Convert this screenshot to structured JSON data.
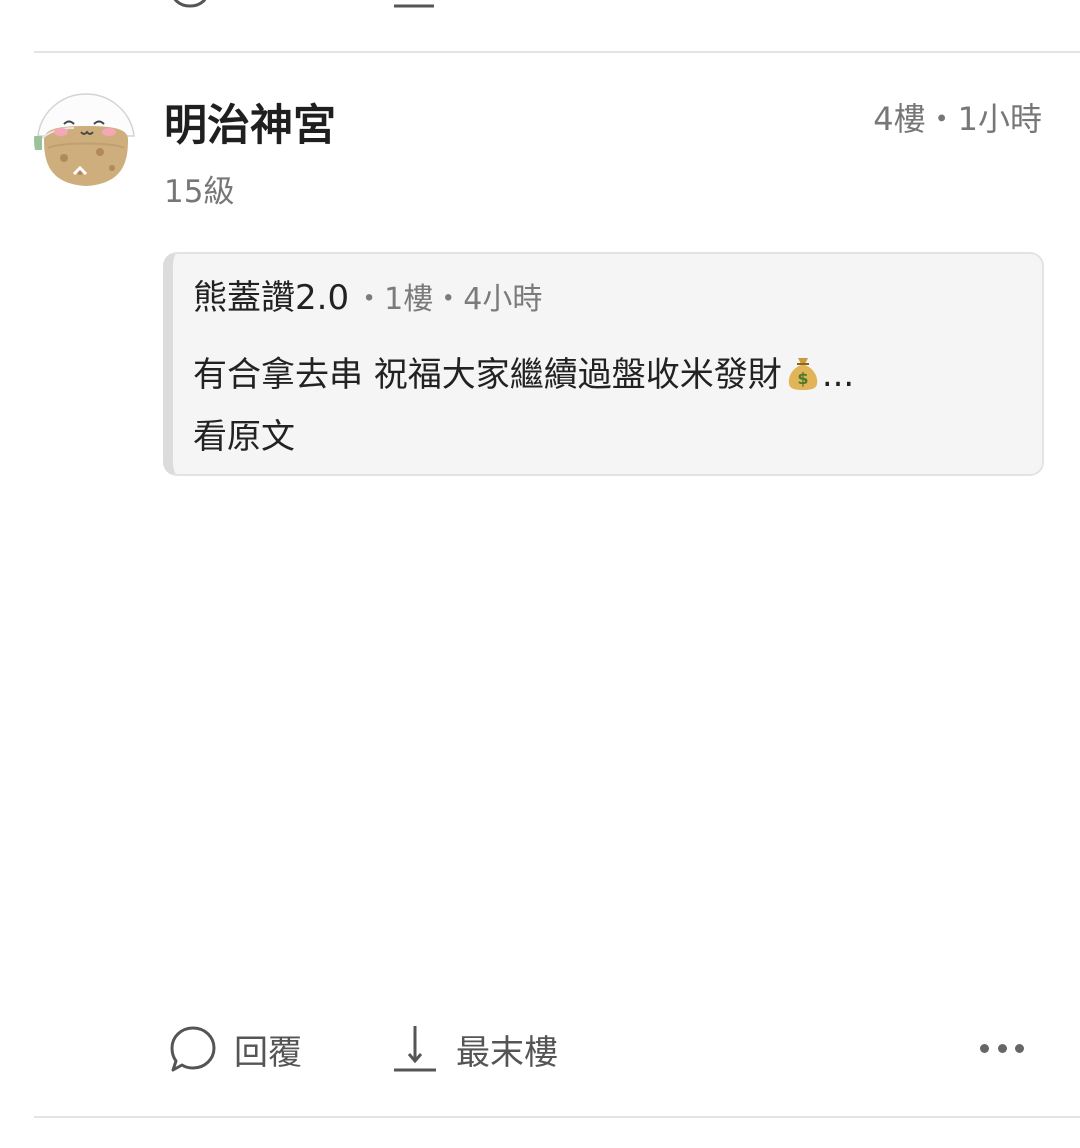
{
  "post": {
    "author": "明治神宮",
    "level": "15級",
    "floor": "4樓",
    "time": "1小時",
    "meta_separator": "・"
  },
  "quote": {
    "author": "熊蓋讚2.0",
    "floor": "1樓",
    "time": "4小時",
    "text": "有合拿去串 祝福大家繼續過盤收米發財",
    "emoji_icon": "money-bag-icon",
    "ellipsis": "...",
    "view_original": "看原文"
  },
  "actions": {
    "reply_label": "回覆",
    "last_floor_label": "最末樓",
    "more_icon": "more-horizontal-icon"
  },
  "colors": {
    "divider": "#e4e4e4",
    "quote_background": "#f5f5f5",
    "secondary_text": "#777777"
  }
}
